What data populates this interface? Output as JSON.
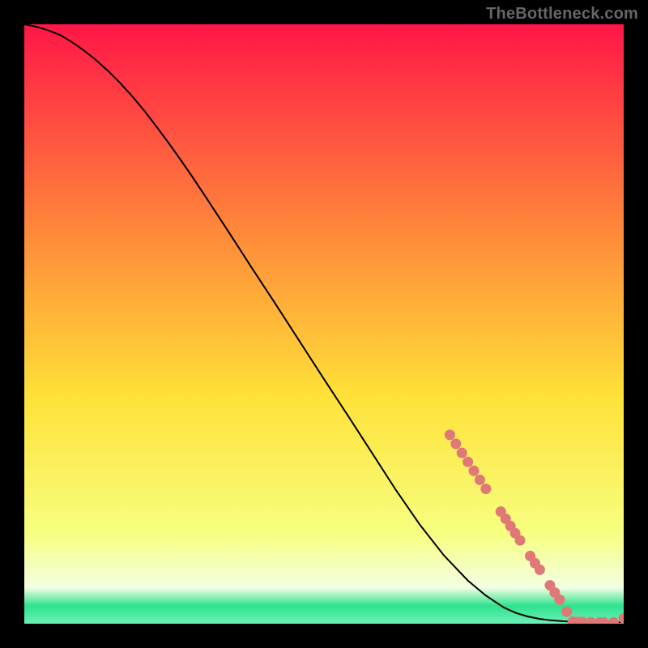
{
  "attribution": "TheBottleneck.com",
  "colors": {
    "page_bg": "#000000",
    "curve_color": "#000000",
    "marker_color": "#e07878",
    "attribution_color": "#666666",
    "grad_top": "#ff1647",
    "grad_mid_upper": "#ff8a3a",
    "grad_mid": "#ffe138",
    "grad_mid_lower": "#f6ff80",
    "grad_pale": "#f3ffe3",
    "grad_green": "#2fe28d",
    "grad_bottom": "#6df0b7"
  },
  "chart_data": {
    "type": "line",
    "title": "",
    "xlabel": "",
    "ylabel": "",
    "xlim": [
      0,
      100
    ],
    "ylim": [
      0,
      100
    ],
    "series": [
      {
        "name": "bottleneck-curve",
        "x": [
          0,
          2,
          4,
          6,
          8,
          10,
          12,
          14,
          16,
          18,
          20,
          22,
          24,
          26,
          28,
          30,
          34,
          38,
          42,
          46,
          50,
          54,
          58,
          62,
          66,
          70,
          74,
          77,
          80,
          82,
          84,
          86,
          88,
          90,
          92,
          94,
          96,
          98,
          100
        ],
        "y": [
          100,
          99.6,
          99.0,
          98.2,
          97.0,
          95.6,
          94.0,
          92.2,
          90.2,
          88.0,
          85.6,
          83.0,
          80.3,
          77.5,
          74.6,
          71.6,
          65.5,
          59.3,
          53.2,
          47.0,
          40.8,
          34.7,
          28.5,
          22.3,
          16.5,
          11.4,
          7.2,
          4.7,
          2.7,
          1.8,
          1.2,
          0.8,
          0.55,
          0.4,
          0.3,
          0.25,
          0.22,
          0.22,
          0.25
        ]
      }
    ],
    "markers": [
      {
        "x": 71,
        "y": 31.5
      },
      {
        "x": 72,
        "y": 30.0
      },
      {
        "x": 73,
        "y": 28.5
      },
      {
        "x": 74,
        "y": 27.0
      },
      {
        "x": 75,
        "y": 25.5
      },
      {
        "x": 76,
        "y": 24.0
      },
      {
        "x": 77,
        "y": 22.5
      },
      {
        "x": 79.5,
        "y": 18.7
      },
      {
        "x": 80.3,
        "y": 17.5
      },
      {
        "x": 81.1,
        "y": 16.3
      },
      {
        "x": 81.9,
        "y": 15.1
      },
      {
        "x": 82.7,
        "y": 13.9
      },
      {
        "x": 84.4,
        "y": 11.3
      },
      {
        "x": 85.2,
        "y": 10.1
      },
      {
        "x": 86.0,
        "y": 9.0
      },
      {
        "x": 87.7,
        "y": 6.4
      },
      {
        "x": 88.5,
        "y": 5.2
      },
      {
        "x": 89.3,
        "y": 4.0
      },
      {
        "x": 90.5,
        "y": 2.0
      },
      {
        "x": 91.5,
        "y": 0.35
      },
      {
        "x": 92.3,
        "y": 0.3
      },
      {
        "x": 93.1,
        "y": 0.28
      },
      {
        "x": 94.5,
        "y": 0.25
      },
      {
        "x": 96.0,
        "y": 0.22
      },
      {
        "x": 96.7,
        "y": 0.22
      },
      {
        "x": 98.3,
        "y": 0.23
      },
      {
        "x": 100,
        "y": 0.9
      }
    ]
  }
}
